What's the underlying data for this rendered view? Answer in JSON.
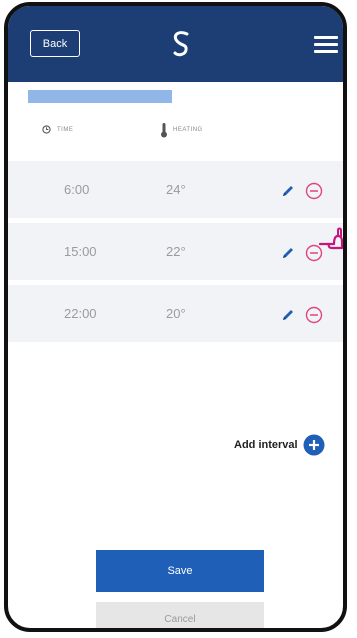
{
  "topbar": {
    "back_label": "Back",
    "logo_icon": "brand-logo-icon",
    "menu_icon": "menu-icon",
    "bg_color": "#1c3e74"
  },
  "table": {
    "time_header": "TIME",
    "heating_header": "HEATING",
    "time_icon": "clock-icon",
    "heating_icon": "thermometer-icon",
    "rows": [
      {
        "time": "6:00",
        "temp": "24°"
      },
      {
        "time": "15:00",
        "temp": "22°"
      },
      {
        "time": "22:00",
        "temp": "20°"
      }
    ]
  },
  "actions": {
    "add_interval_label": "Add interval",
    "save_label": "Save",
    "cancel_label": "Cancel"
  },
  "colors": {
    "accent": "#1f5fb8",
    "remove": "#e0457e",
    "row_bg": "#f1f3f6"
  }
}
